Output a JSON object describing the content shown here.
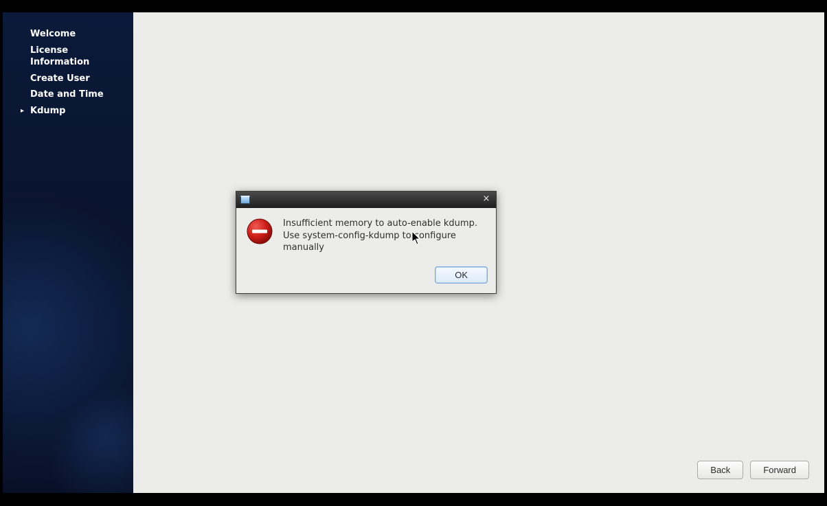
{
  "sidebar": {
    "items": [
      {
        "label": "Welcome",
        "active": false
      },
      {
        "label": "License Information",
        "active": false
      },
      {
        "label": "Create User",
        "active": false
      },
      {
        "label": "Date and Time",
        "active": false
      },
      {
        "label": "Kdump",
        "active": true
      }
    ]
  },
  "dialog": {
    "icon": "error-icon",
    "message_line1": "Insufficient memory to auto-enable kdump.",
    "message_line2": "Use system-config-kdump to configure manually",
    "ok_label": "OK",
    "close_label": "×"
  },
  "footer": {
    "back_label": "Back",
    "forward_label": "Forward"
  }
}
